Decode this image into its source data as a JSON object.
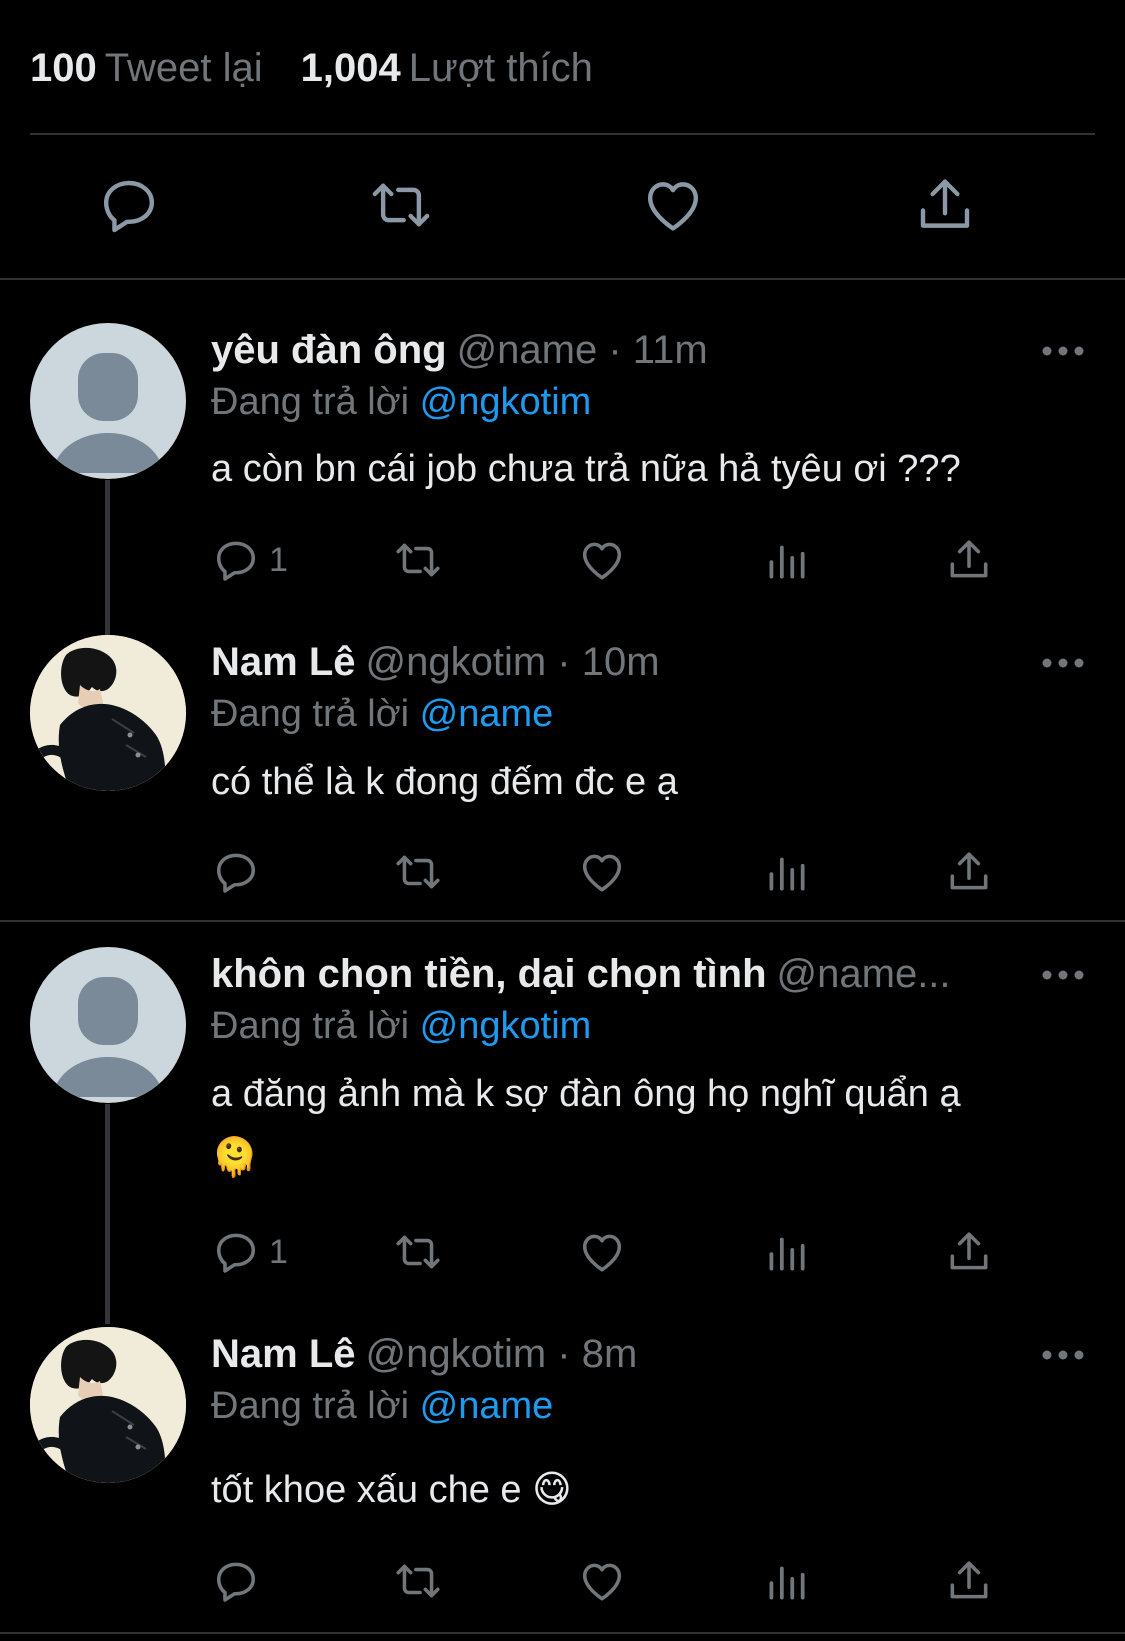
{
  "stats": {
    "retweets_count": "100",
    "retweets_label": "Tweet lại",
    "likes_count": "1,004",
    "likes_label": "Lượt thích"
  },
  "colors": {
    "background": "#000000",
    "text_primary": "#e7e9ea",
    "text_secondary": "#71767b",
    "mention": "#1d9bf0",
    "divider": "#2f3336"
  },
  "main_actions": [
    "reply-icon",
    "retweet-icon",
    "like-icon",
    "share-icon"
  ],
  "replies": [
    {
      "name": "yêu đàn ông",
      "handle": "@name · 11m",
      "replying_label": "Đang trả lời",
      "replying_to": "@ngkotim",
      "text": "a còn bn cái job chưa trả nữa hả tyêu ơi ???",
      "reply_count": "1",
      "avatar": "default-avatar"
    },
    {
      "name": "Nam Lê",
      "handle": "@ngkotim · 10m",
      "replying_label": "Đang trả lời",
      "replying_to": "@name",
      "text": "có thể là k đong đếm đc e ạ",
      "reply_count": "",
      "avatar": "profile-photo"
    },
    {
      "name": "khôn chọn tiền, dại chọn tình",
      "handle": "@name...",
      "replying_label": "Đang trả lời",
      "replying_to": "@ngkotim",
      "text": "a đăng ảnh mà k sợ đàn ông họ nghĩ quẩn ạ",
      "emoji": "🫠",
      "reply_count": "1",
      "avatar": "default-avatar"
    },
    {
      "name": "Nam Lê",
      "handle": "@ngkotim · 8m",
      "replying_label": "Đang trả lời",
      "replying_to": "@name",
      "text": "tốt khoe xấu che e",
      "emoji": "😋",
      "reply_count": "",
      "avatar": "profile-photo"
    }
  ]
}
